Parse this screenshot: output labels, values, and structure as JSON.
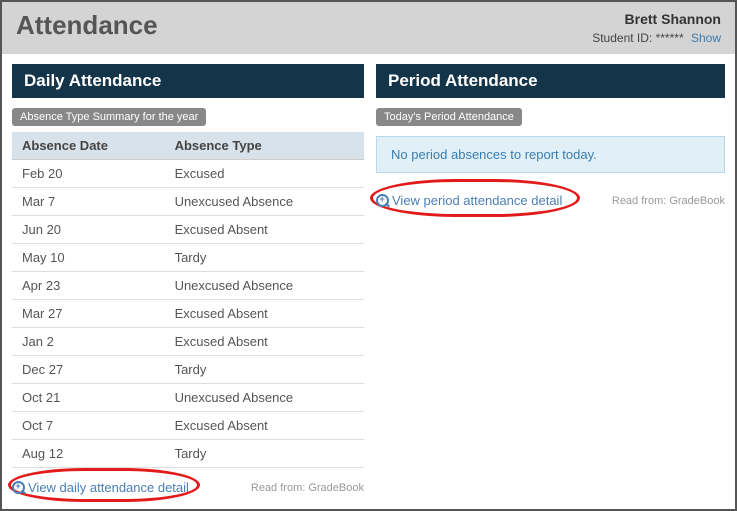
{
  "header": {
    "title": "Attendance",
    "studentName": "Brett Shannon",
    "studentIdLabel": "Student ID:",
    "studentIdMasked": "******",
    "showLabel": "Show"
  },
  "daily": {
    "panelTitle": "Daily Attendance",
    "badge": "Absence Type Summary for the year",
    "col1": "Absence Date",
    "col2": "Absence Type",
    "rows": [
      {
        "date": "Feb 20",
        "type": "Excused"
      },
      {
        "date": "Mar 7",
        "type": "Unexcused Absence"
      },
      {
        "date": "Jun 20",
        "type": "Excused Absent"
      },
      {
        "date": "May 10",
        "type": "Tardy"
      },
      {
        "date": "Apr 23",
        "type": "Unexcused Absence"
      },
      {
        "date": "Mar 27",
        "type": "Excused Absent"
      },
      {
        "date": "Jan 2",
        "type": "Excused Absent"
      },
      {
        "date": "Dec 27",
        "type": "Tardy"
      },
      {
        "date": "Oct 21",
        "type": "Unexcused Absence"
      },
      {
        "date": "Oct 7",
        "type": "Excused Absent"
      },
      {
        "date": "Aug 12",
        "type": "Tardy"
      }
    ],
    "viewLink": "View daily attendance detail",
    "readFrom": "Read from: GradeBook"
  },
  "period": {
    "panelTitle": "Period Attendance",
    "badge": "Today's Period Attendance",
    "noAbsences": "No period absences to report today.",
    "viewLink": "View period attendance detail",
    "readFrom": "Read from: GradeBook"
  }
}
